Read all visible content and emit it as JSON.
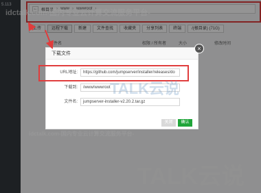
{
  "sidebar": {
    "ip": "5.113",
    "items": [
      "",
      "",
      "",
      ""
    ]
  },
  "pathbar": {
    "back": "←",
    "crumbs": [
      "根目录",
      "www",
      "wwwroot"
    ]
  },
  "toolbar": {
    "upload": "上传",
    "remote_download": "远程下载",
    "new": "新建",
    "file_search": "文件查找",
    "favorites": "收藏夹",
    "share_list": "分享列表",
    "terminal": "终端",
    "disk": "/(根目录) (71G)"
  },
  "table_header": {
    "filename": "文件名",
    "permission": "权限 / 所有者",
    "size": "大小",
    "mtime": "修改时间"
  },
  "dialog": {
    "title": "下载文件",
    "url_label": "URL地址:",
    "url_value": "https://github.com/jumpserver/installer/releases/do",
    "dir_label": "下载到:",
    "dir_value": "/www/wwwroot",
    "filename_label": "文件名:",
    "filename_value": "jumpserver-installer-v2.20.2.tar.gz",
    "cancel": "关闭",
    "ok": "确认",
    "close_glyph": "×"
  },
  "watermark": {
    "line1": "idctalk.com-国内专业云计算交流服务平台-",
    "brand": "TALK云说",
    "line2": "idctalk.com-国内专业云计算交流服务平台-"
  },
  "colors": {
    "highlight": "#e03c3c",
    "confirm": "#20a53a",
    "sidebar": "#33373d"
  }
}
